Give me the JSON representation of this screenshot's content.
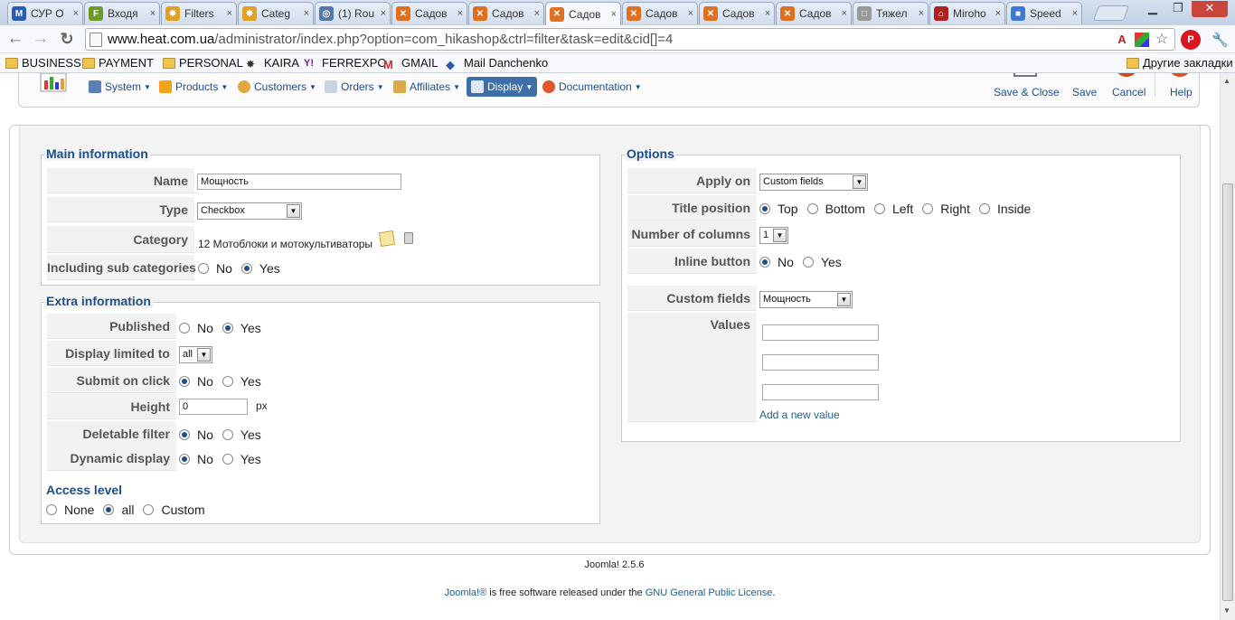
{
  "browser": {
    "tabs": [
      {
        "title": "СУР О",
        "favicon": "M",
        "color": "#2a5db0"
      },
      {
        "title": "Входя",
        "favicon": "F",
        "color": "#6a9b2a"
      },
      {
        "title": "Filters",
        "favicon": "✸",
        "color": "#e0a020"
      },
      {
        "title": "Categ",
        "favicon": "✸",
        "color": "#e0a020"
      },
      {
        "title": "(1) Rou",
        "favicon": "◎",
        "color": "#5577aa"
      },
      {
        "title": "Садов",
        "favicon": "✕",
        "color": "#e07020"
      },
      {
        "title": "Садов",
        "favicon": "✕",
        "color": "#e07020"
      },
      {
        "title": "Садов",
        "favicon": "✕",
        "color": "#e07020",
        "active": true
      },
      {
        "title": "Садов",
        "favicon": "✕",
        "color": "#e07020"
      },
      {
        "title": "Садов",
        "favicon": "✕",
        "color": "#e07020"
      },
      {
        "title": "Садов",
        "favicon": "✕",
        "color": "#e07020"
      },
      {
        "title": "Тяжел",
        "favicon": "□",
        "color": "#999999"
      },
      {
        "title": "Miroho",
        "favicon": "⌂",
        "color": "#b02020"
      },
      {
        "title": "Speed",
        "favicon": "■",
        "color": "#3a7ad0"
      }
    ],
    "url_host": "www.heat.com.ua",
    "url_path": "/administrator/index.php?option=com_hikashop&ctrl=filter&task=edit&cid[]=4",
    "bookmarks": [
      "BUSINESS",
      "PAYMENT",
      "PERSONAL",
      "KAIRA",
      "FERREXPO",
      "GMAIL",
      "Mail Danchenko"
    ],
    "other_bookmarks": "Другие закладки"
  },
  "toolbar": {
    "menus": [
      "System",
      "Products",
      "Customers",
      "Orders",
      "Affiliates",
      "Display",
      "Documentation"
    ],
    "active_menu": "Display",
    "save_close": "Save & Close",
    "save": "Save",
    "cancel": "Cancel",
    "help": "Help"
  },
  "main_info": {
    "legend": "Main information",
    "name_label": "Name",
    "name_value": "Мощность",
    "type_label": "Type",
    "type_value": "Checkbox",
    "category_label": "Category",
    "category_value": "12 Мотоблоки и мотокультиваторы",
    "subcat_label": "Including sub categories",
    "no": "No",
    "yes": "Yes"
  },
  "extra_info": {
    "legend": "Extra information",
    "published_label": "Published",
    "display_limited_label": "Display limited to",
    "display_limited_value": "all",
    "submit_label": "Submit on click",
    "height_label": "Height",
    "height_value": "0",
    "height_unit": "px",
    "deletable_label": "Deletable filter",
    "dynamic_label": "Dynamic display",
    "no": "No",
    "yes": "Yes",
    "access_legend": "Access level",
    "access_none": "None",
    "access_all": "all",
    "access_custom": "Custom"
  },
  "options": {
    "legend": "Options",
    "apply_on_label": "Apply on",
    "apply_on_value": "Custom fields",
    "title_position_label": "Title position",
    "positions": [
      "Top",
      "Bottom",
      "Left",
      "Right",
      "Inside"
    ],
    "columns_label": "Number of columns",
    "columns_value": "1",
    "inline_label": "Inline button",
    "no": "No",
    "yes": "Yes",
    "custom_fields_label": "Custom fields",
    "custom_fields_value": "Мощность",
    "values_label": "Values",
    "add_value_link": "Add a new value"
  },
  "footer": {
    "version": "Joomla! 2.5.6",
    "joomla": "Joomla!®",
    "free_text": " is free software released under the ",
    "license": "GNU General Public License",
    "dot": "."
  }
}
